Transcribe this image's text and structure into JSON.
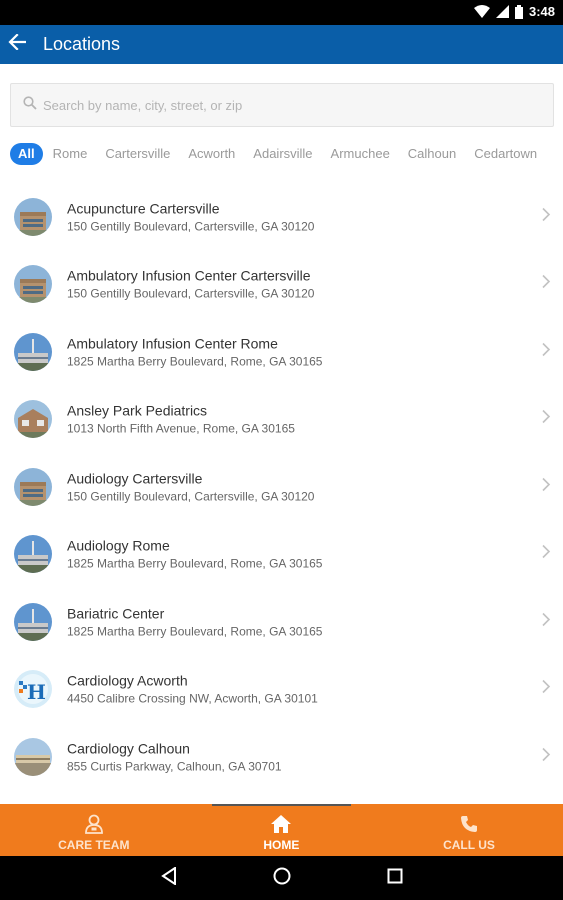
{
  "status_bar": {
    "time": "3:48"
  },
  "app_bar": {
    "title": "Locations"
  },
  "search": {
    "placeholder": "Search by name, city, street, or zip",
    "value": ""
  },
  "filters": [
    "All",
    "Rome",
    "Cartersville",
    "Acworth",
    "Adairsville",
    "Armuchee",
    "Calhoun",
    "Cedartown"
  ],
  "locations": [
    {
      "name": "Acupuncture Cartersville",
      "address": "150 Gentilly Boulevard, Cartersville, GA 30120"
    },
    {
      "name": "Ambulatory Infusion Center Cartersville",
      "address": "150 Gentilly Boulevard, Cartersville, GA 30120"
    },
    {
      "name": "Ambulatory Infusion Center Rome",
      "address": "1825 Martha Berry Boulevard, Rome, GA 30165"
    },
    {
      "name": "Ansley Park Pediatrics",
      "address": "1013 North Fifth Avenue, Rome, GA 30165"
    },
    {
      "name": "Audiology Cartersville",
      "address": "150 Gentilly Boulevard, Cartersville, GA 30120"
    },
    {
      "name": "Audiology Rome",
      "address": "1825 Martha Berry Boulevard, Rome, GA 30165"
    },
    {
      "name": "Bariatric Center",
      "address": "1825 Martha Berry Boulevard, Rome, GA 30165"
    },
    {
      "name": "Cardiology Acworth",
      "address": "4450 Calibre Crossing NW, Acworth, GA 30101"
    },
    {
      "name": "Cardiology Calhoun",
      "address": "855 Curtis Parkway, Calhoun, GA 30701"
    }
  ],
  "bottom_nav": {
    "care_team": "CARE TEAM",
    "home": "HOME",
    "call_us": "CALL US"
  }
}
